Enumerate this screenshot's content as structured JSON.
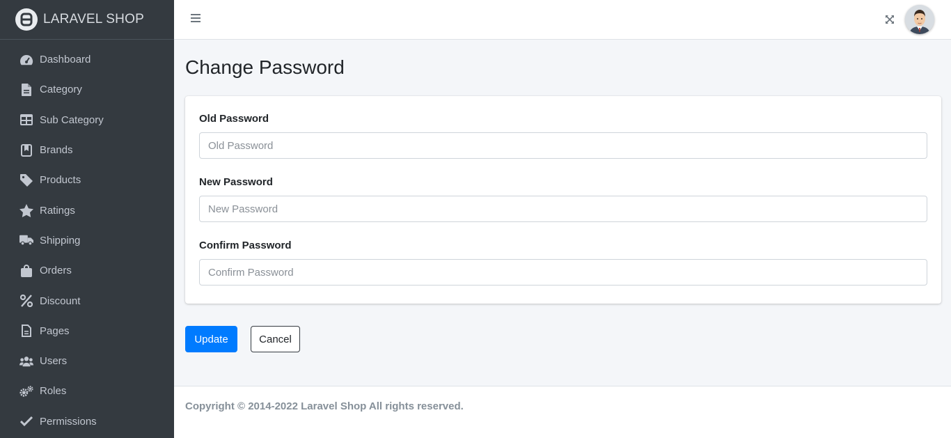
{
  "brand": {
    "name": "LARAVEL SHOP",
    "logo_icon": "brand-logo-icon"
  },
  "sidebar": {
    "items": [
      {
        "label": "Dashboard",
        "icon": "tachometer-icon"
      },
      {
        "label": "Category",
        "icon": "file-icon"
      },
      {
        "label": "Sub Category",
        "icon": "table-icon"
      },
      {
        "label": "Brands",
        "icon": "bookmark-icon"
      },
      {
        "label": "Products",
        "icon": "tag-icon"
      },
      {
        "label": "Ratings",
        "icon": "star-icon"
      },
      {
        "label": "Shipping",
        "icon": "truck-icon"
      },
      {
        "label": "Orders",
        "icon": "shopping-bag-icon"
      },
      {
        "label": "Discount",
        "icon": "percent-icon"
      },
      {
        "label": "Pages",
        "icon": "file-text-icon"
      },
      {
        "label": "Users",
        "icon": "users-icon"
      },
      {
        "label": "Roles",
        "icon": "cogs-icon"
      },
      {
        "label": "Permissions",
        "icon": "check-icon"
      }
    ]
  },
  "topbar": {
    "menu_icon": "hamburger-icon",
    "fullscreen_icon": "expand-icon",
    "avatar": "user-avatar"
  },
  "main": {
    "title": "Change Password",
    "fields": [
      {
        "label": "Old Password",
        "placeholder": "Old Password",
        "value": ""
      },
      {
        "label": "New Password",
        "placeholder": "New Password",
        "value": ""
      },
      {
        "label": "Confirm Password",
        "placeholder": "Confirm Password",
        "value": ""
      }
    ],
    "buttons": {
      "update": "Update",
      "cancel": "Cancel"
    }
  },
  "footer": {
    "text": "Copyright © 2014-2022 Laravel Shop All rights reserved."
  },
  "colors": {
    "sidebar_bg": "#343a40",
    "primary": "#007bff",
    "page_bg": "#f4f6f9",
    "footer_text": "#869099"
  }
}
